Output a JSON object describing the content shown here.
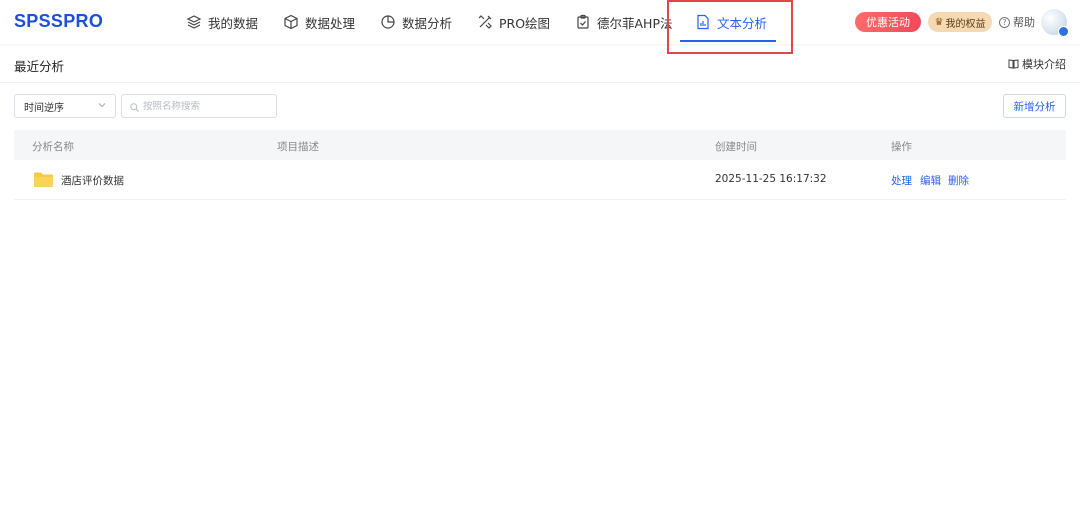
{
  "app": {
    "logo": "SPSSPRO"
  },
  "nav": {
    "items": [
      {
        "label": "我的数据",
        "icon": "layers-icon"
      },
      {
        "label": "数据处理",
        "icon": "cube-icon"
      },
      {
        "label": "数据分析",
        "icon": "pie-chart-icon"
      },
      {
        "label": "PRO绘图",
        "icon": "drawing-tools-icon"
      },
      {
        "label": "德尔菲AHP法",
        "icon": "clipboard-check-icon"
      },
      {
        "label": "文本分析",
        "icon": "document-chart-icon",
        "active": true
      }
    ]
  },
  "header": {
    "promo_label": "优惠活动",
    "rights_label": "我的权益",
    "help_label": "帮助"
  },
  "page": {
    "title": "最近分析",
    "intro_label": "模块介绍"
  },
  "toolbar": {
    "sort_value": "时间逆序",
    "search_placeholder": "按照名称搜索",
    "add_label": "新增分析"
  },
  "table": {
    "columns": [
      "分析名称",
      "项目描述",
      "创建时间",
      "操作"
    ],
    "rows": [
      {
        "name": "酒店评价数据",
        "description": "",
        "created": "2025-11-25 16:17:32",
        "actions": [
          "处理",
          "编辑",
          "删除"
        ]
      }
    ]
  },
  "colors": {
    "accent": "#2563eb",
    "promo": "#f04a5a",
    "rights": "#f4d9b4",
    "highlight": "#e0474c"
  }
}
